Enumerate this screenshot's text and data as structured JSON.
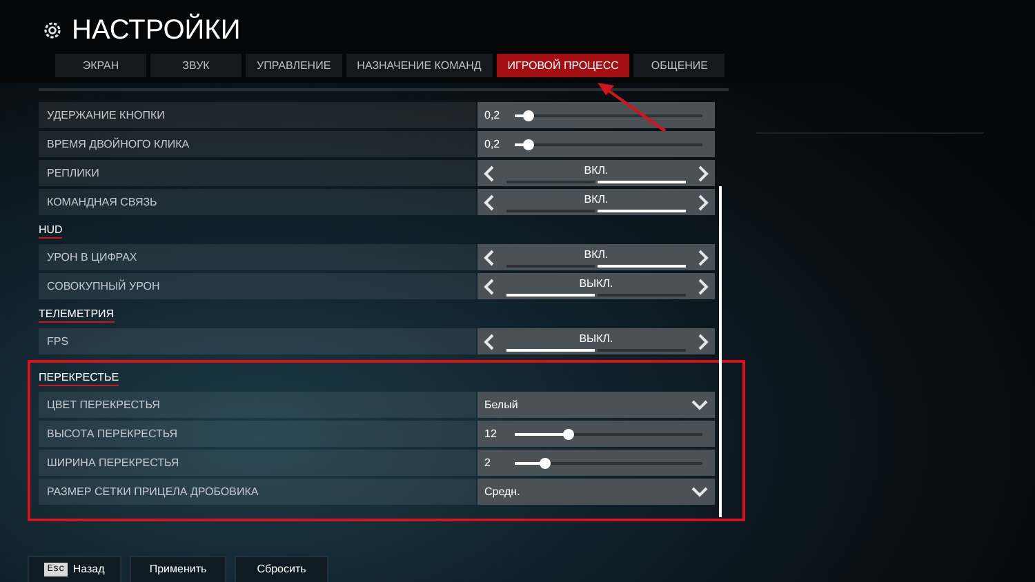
{
  "title": "НАСТРОЙКИ",
  "tabs": [
    {
      "label": "ЭКРАН",
      "selected": false
    },
    {
      "label": "ЗВУК",
      "selected": false
    },
    {
      "label": "УПРАВЛЕНИЕ",
      "selected": false
    },
    {
      "label": "НАЗНАЧЕНИЕ КОМАНД",
      "selected": false
    },
    {
      "label": "ИГРОВОЙ ПРОЦЕСС",
      "selected": true
    },
    {
      "label": "ОБЩЕНИЕ",
      "selected": false
    }
  ],
  "sections": [
    {
      "highlighted": false,
      "rows": [
        {
          "kind": "slider",
          "label": "УДЕРЖАНИЕ КНОПКИ",
          "value": "0,2",
          "level": 0.07
        },
        {
          "kind": "slider",
          "label": "ВРЕМЯ ДВОЙНОГО КЛИКА",
          "value": "0,2",
          "level": 0.07
        },
        {
          "kind": "toggle",
          "label": "РЕПЛИКИ",
          "value": "ВКЛ.",
          "on": true
        },
        {
          "kind": "toggle",
          "label": "КОМАНДНАЯ СВЯЗЬ",
          "value": "ВКЛ.",
          "on": true
        }
      ]
    },
    {
      "title": "HUD",
      "highlighted": false,
      "rows": [
        {
          "kind": "toggle",
          "label": "УРОН В ЦИФРАХ",
          "value": "ВКЛ.",
          "on": true
        },
        {
          "kind": "toggle",
          "label": "СОВОКУПНЫЙ УРОН",
          "value": "ВЫКЛ.",
          "on": false
        }
      ]
    },
    {
      "title": "ТЕЛЕМЕТРИЯ",
      "highlighted": false,
      "rows": [
        {
          "kind": "toggle",
          "label": "FPS",
          "value": "ВЫКЛ.",
          "on": false
        }
      ]
    },
    {
      "title": "ПЕРЕКРЕСТЬЕ",
      "highlighted": true,
      "rows": [
        {
          "kind": "dropdown",
          "label": "ЦВЕТ ПЕРЕКРЕСТЬЯ",
          "value": "Белый"
        },
        {
          "kind": "slider",
          "label": "ВЫСОТА ПЕРЕКРЕСТЬЯ",
          "value": "12",
          "level": 0.29
        },
        {
          "kind": "slider",
          "label": "ШИРИНА ПЕРЕКРЕСТЬЯ",
          "value": "2",
          "level": 0.16
        },
        {
          "kind": "dropdown",
          "label": "РАЗМЕР СЕТКИ ПРИЦЕЛА ДРОБОВИКА",
          "value": "Средн."
        }
      ]
    }
  ],
  "footer": {
    "back_key": "Esc",
    "back": "Назад",
    "apply": "Применить",
    "reset": "Сбросить"
  }
}
